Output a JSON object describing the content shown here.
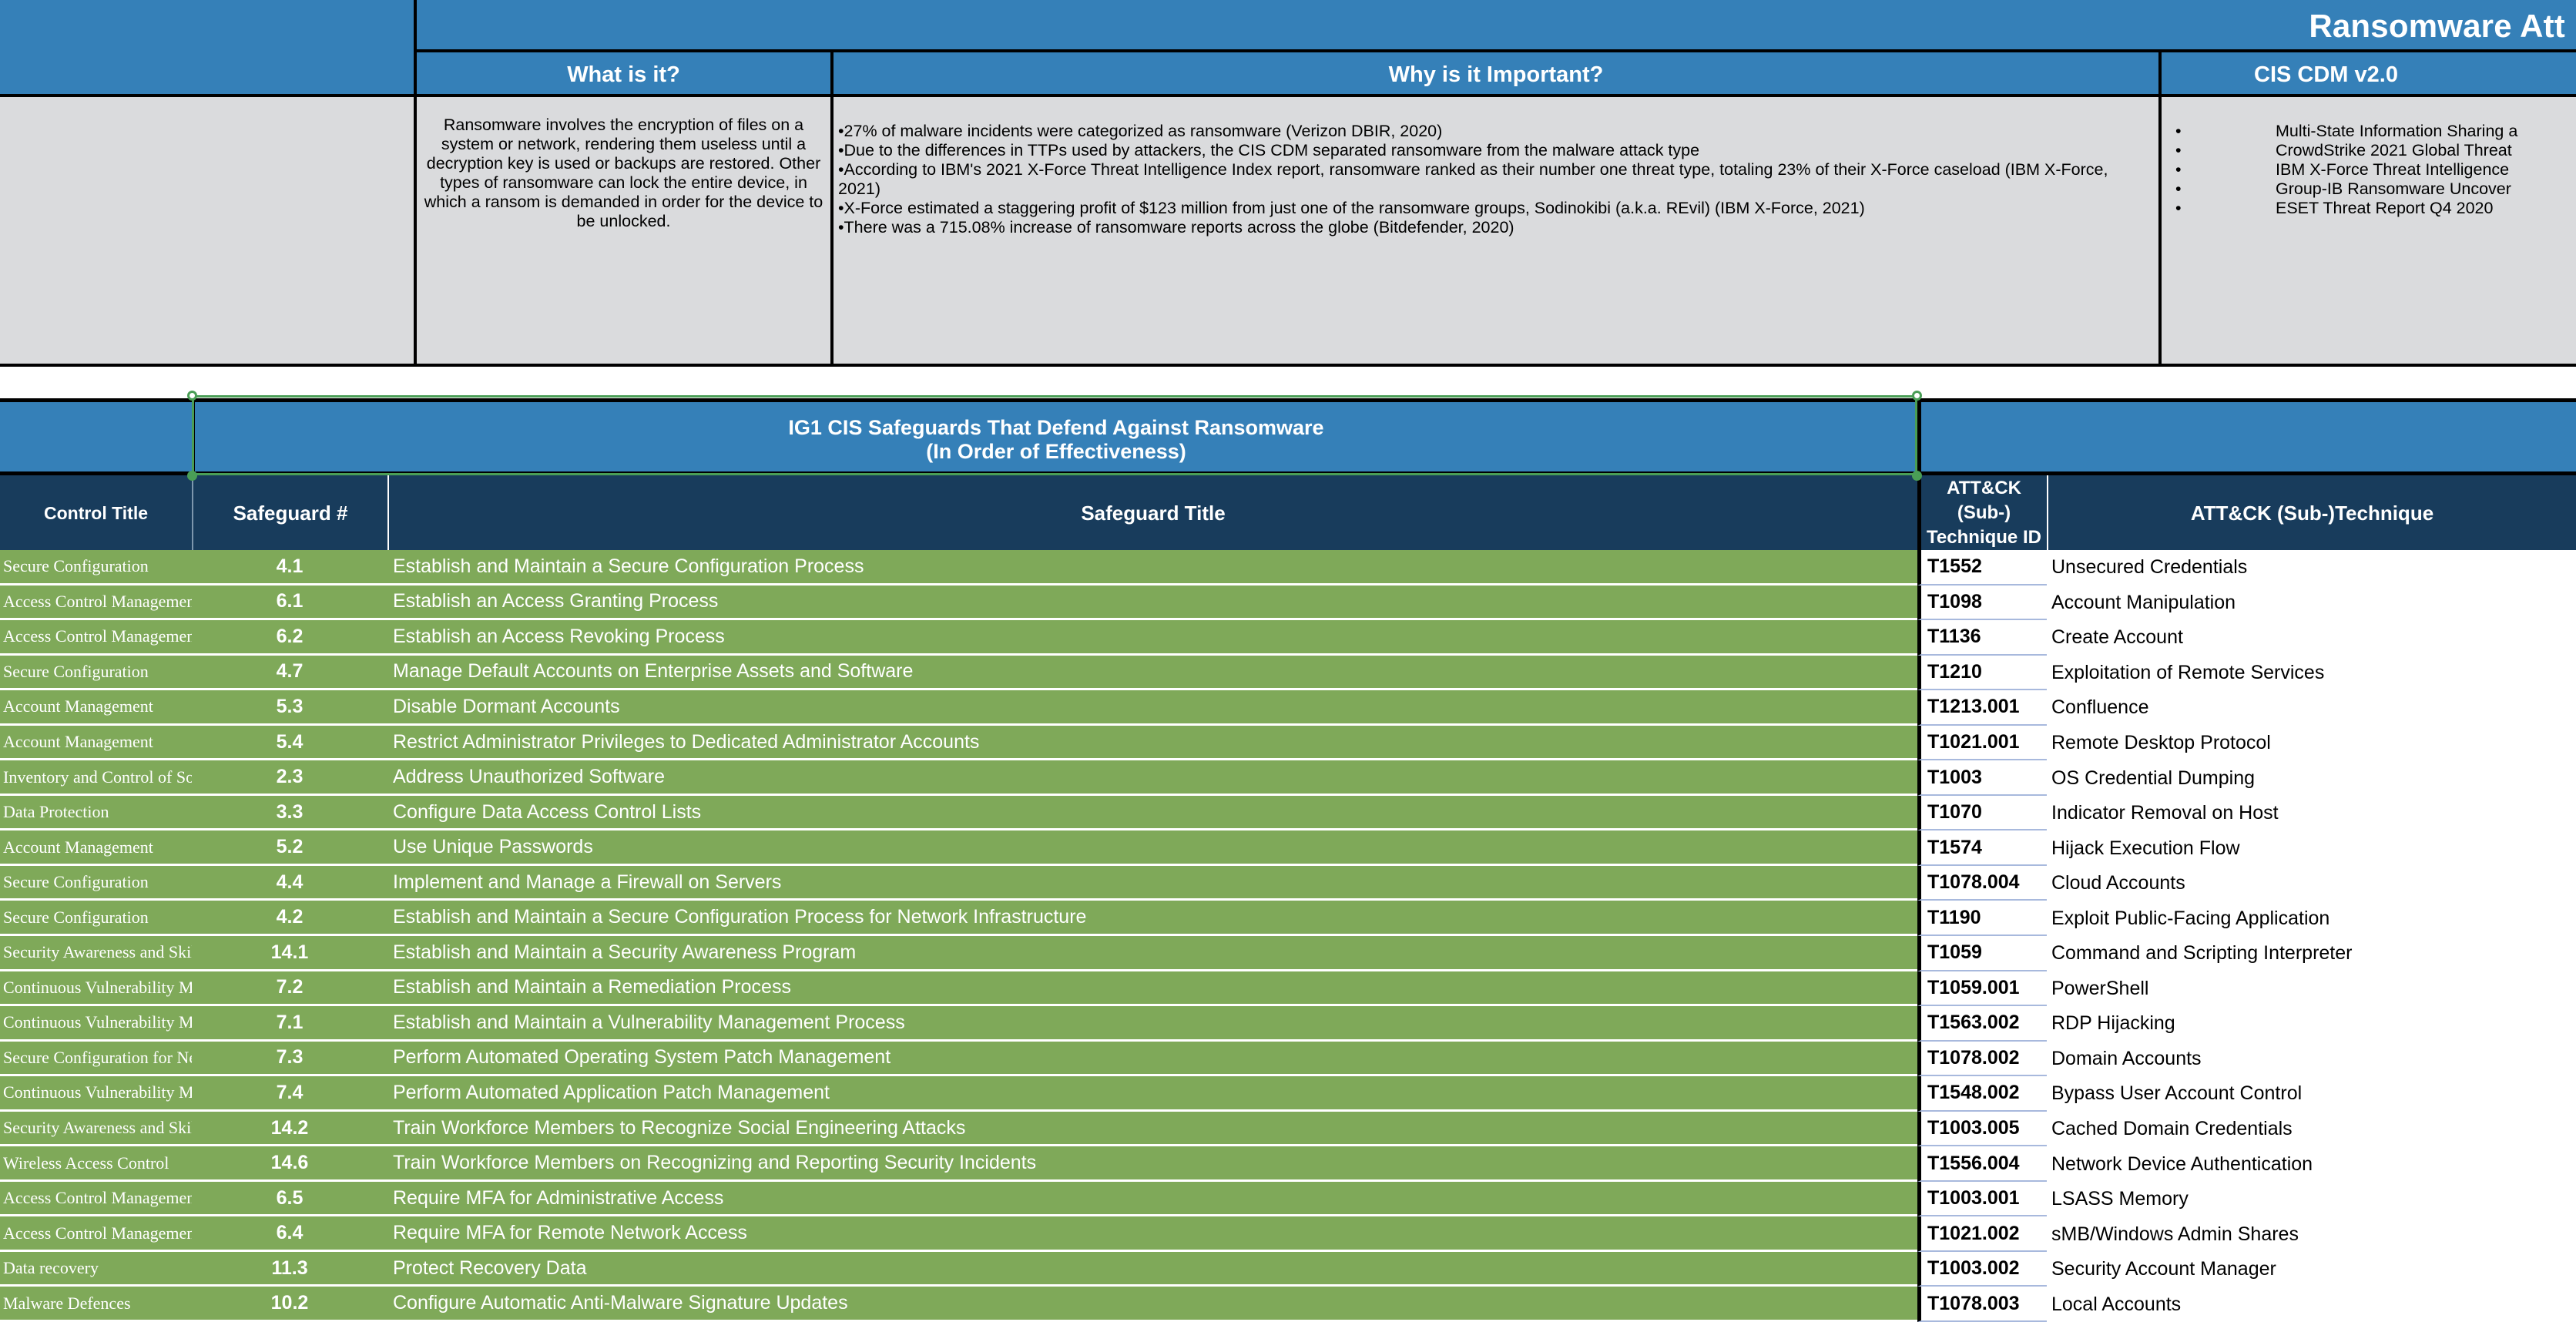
{
  "header": {
    "main_title": "Ransomware Att",
    "columns": {
      "spacer": "",
      "what_is_it": "What is it?",
      "why_important": "Why is it Important?",
      "cis_cdm": "CIS CDM v2.0"
    },
    "what_is_it_body": "Ransomware involves the encryption of files on a system or network, rendering them useless until a decryption key is used or backups are restored. Other types of ransomware can lock the entire device, in which a ransom is demanded in order for the device to be unlocked.",
    "why_important_bullets": [
      "•27% of malware incidents were categorized as ransomware (Verizon DBIR, 2020)",
      "•Due to the differences in TTPs used by attackers, the CIS CDM separated ransomware from the malware attack type",
      "•According to IBM's 2021 X-Force Threat Intelligence Index report, ransomware ranked as their number one threat type, totaling 23% of their X-Force caseload (IBM X-Force, 2021)",
      "•X-Force estimated a staggering profit of $123 million from just one of the ransomware groups, Sodinokibi (a.k.a. REvil) (IBM X-Force, 2021)",
      "•There was a 715.08% increase of ransomware reports across the globe (Bitdefender, 2020)"
    ],
    "cis_cdm_sources": [
      "Multi-State Information Sharing a",
      "CrowdStrike 2021 Global Threat",
      "IBM X-Force Threat Intelligence",
      "Group-IB Ransomware Uncover",
      "ESET Threat Report Q4 2020"
    ]
  },
  "banner": {
    "line1": "IG1 CIS Safeguards That Defend Against Ransomware",
    "line2": "(In Order of Effectiveness)"
  },
  "table": {
    "headers": {
      "control_title": "Control Title",
      "safeguard_number": "Safeguard #",
      "safeguard_title": "Safeguard Title",
      "attack_id": "ATT&CK (Sub-) Technique ID",
      "attack_name": "ATT&CK (Sub-)Technique"
    },
    "rows": [
      {
        "control_title": "Secure Configuration",
        "safeguard": "4.1",
        "safeguard_title": "Establish and Maintain a Secure Configuration Process",
        "attack_id": "T1552",
        "attack_name": "Unsecured Credentials"
      },
      {
        "control_title": "Access Control Management",
        "safeguard": "6.1",
        "safeguard_title": "Establish an Access Granting Process",
        "attack_id": "T1098",
        "attack_name": "Account Manipulation"
      },
      {
        "control_title": "Access Control Management",
        "safeguard": "6.2",
        "safeguard_title": "Establish an Access Revoking Process",
        "attack_id": "T1136",
        "attack_name": "Create Account"
      },
      {
        "control_title": "Secure Configuration",
        "safeguard": "4.7",
        "safeguard_title": "Manage Default Accounts on Enterprise Assets and Software",
        "attack_id": "T1210",
        "attack_name": "Exploitation of Remote Services"
      },
      {
        "control_title": "Account Management",
        "safeguard": "5.3",
        "safeguard_title": "Disable Dormant Accounts",
        "attack_id": "T1213.001",
        "attack_name": "Confluence"
      },
      {
        "control_title": "Account Management",
        "safeguard": "5.4",
        "safeguard_title": "Restrict Administrator Privileges to Dedicated Administrator Accounts",
        "attack_id": "T1021.001",
        "attack_name": "Remote Desktop Protocol"
      },
      {
        "control_title": "Inventory and Control of Software Assets",
        "safeguard": "2.3",
        "safeguard_title": "Address Unauthorized Software",
        "attack_id": "T1003",
        "attack_name": "OS Credential Dumping"
      },
      {
        "control_title": "Data Protection",
        "safeguard": "3.3",
        "safeguard_title": "Configure Data Access Control Lists",
        "attack_id": "T1070",
        "attack_name": "Indicator Removal on Host"
      },
      {
        "control_title": "Account Management",
        "safeguard": "5.2",
        "safeguard_title": "Use Unique Passwords",
        "attack_id": "T1574",
        "attack_name": "Hijack Execution Flow"
      },
      {
        "control_title": "Secure Configuration",
        "safeguard": "4.4",
        "safeguard_title": "Implement and Manage a Firewall on Servers",
        "attack_id": "T1078.004",
        "attack_name": "Cloud Accounts"
      },
      {
        "control_title": "Secure Configuration",
        "safeguard": "4.2",
        "safeguard_title": "Establish and Maintain a Secure Configuration Process for Network Infrastructure",
        "attack_id": "T1190",
        "attack_name": "Exploit Public-Facing Application"
      },
      {
        "control_title": "Security Awareness and Skills Training",
        "safeguard": "14.1",
        "safeguard_title": "Establish and Maintain a Security Awareness Program",
        "attack_id": "T1059",
        "attack_name": "Command and Scripting Interpreter"
      },
      {
        "control_title": "Continuous Vulnerability Management",
        "safeguard": "7.2",
        "safeguard_title": "Establish and Maintain a Remediation Process",
        "attack_id": "T1059.001",
        "attack_name": "PowerShell"
      },
      {
        "control_title": "Continuous Vulnerability Management",
        "safeguard": "7.1",
        "safeguard_title": "Establish and Maintain a Vulnerability Management Process",
        "attack_id": "T1563.002",
        "attack_name": "RDP Hijacking"
      },
      {
        "control_title": "Secure Configuration for Network Devices,",
        "safeguard": "7.3",
        "safeguard_title": "Perform Automated Operating System Patch Management",
        "attack_id": "T1078.002",
        "attack_name": "Domain Accounts"
      },
      {
        "control_title": "Continuous Vulnerability Management",
        "safeguard": "7.4",
        "safeguard_title": "Perform Automated Application Patch Management",
        "attack_id": "T1548.002",
        "attack_name": "Bypass User Account Control"
      },
      {
        "control_title": "Security Awareness and Skills Training",
        "safeguard": "14.2",
        "safeguard_title": "Train Workforce Members to Recognize Social Engineering Attacks",
        "attack_id": "T1003.005",
        "attack_name": "Cached Domain Credentials"
      },
      {
        "control_title": "Wireless Access Control",
        "safeguard": "14.6",
        "safeguard_title": "Train Workforce Members on Recognizing and Reporting Security Incidents",
        "attack_id": "T1556.004",
        "attack_name": "Network Device Authentication"
      },
      {
        "control_title": "Access Control Management",
        "safeguard": "6.5",
        "safeguard_title": "Require MFA for Administrative Access",
        "attack_id": "T1003.001",
        "attack_name": "LSASS Memory"
      },
      {
        "control_title": "Access Control Management",
        "safeguard": "6.4",
        "safeguard_title": "Require MFA for Remote Network Access",
        "attack_id": "T1021.002",
        "attack_name": "sMB/Windows Admin Shares"
      },
      {
        "control_title": "Data recovery",
        "safeguard": "11.3",
        "safeguard_title": "Protect Recovery Data",
        "attack_id": "T1003.002",
        "attack_name": "Security Account Manager"
      },
      {
        "control_title": "Malware Defences",
        "safeguard": "10.2",
        "safeguard_title": "Configure Automatic Anti-Malware Signature Updates",
        "attack_id": "T1078.003",
        "attack_name": "Local Accounts"
      }
    ]
  },
  "colors": {
    "banner_blue": "#3580b8",
    "header_navy": "#183c5c",
    "row_green": "#7fa959",
    "info_grey": "#dadbdd",
    "selection_green": "#4a9e56"
  }
}
